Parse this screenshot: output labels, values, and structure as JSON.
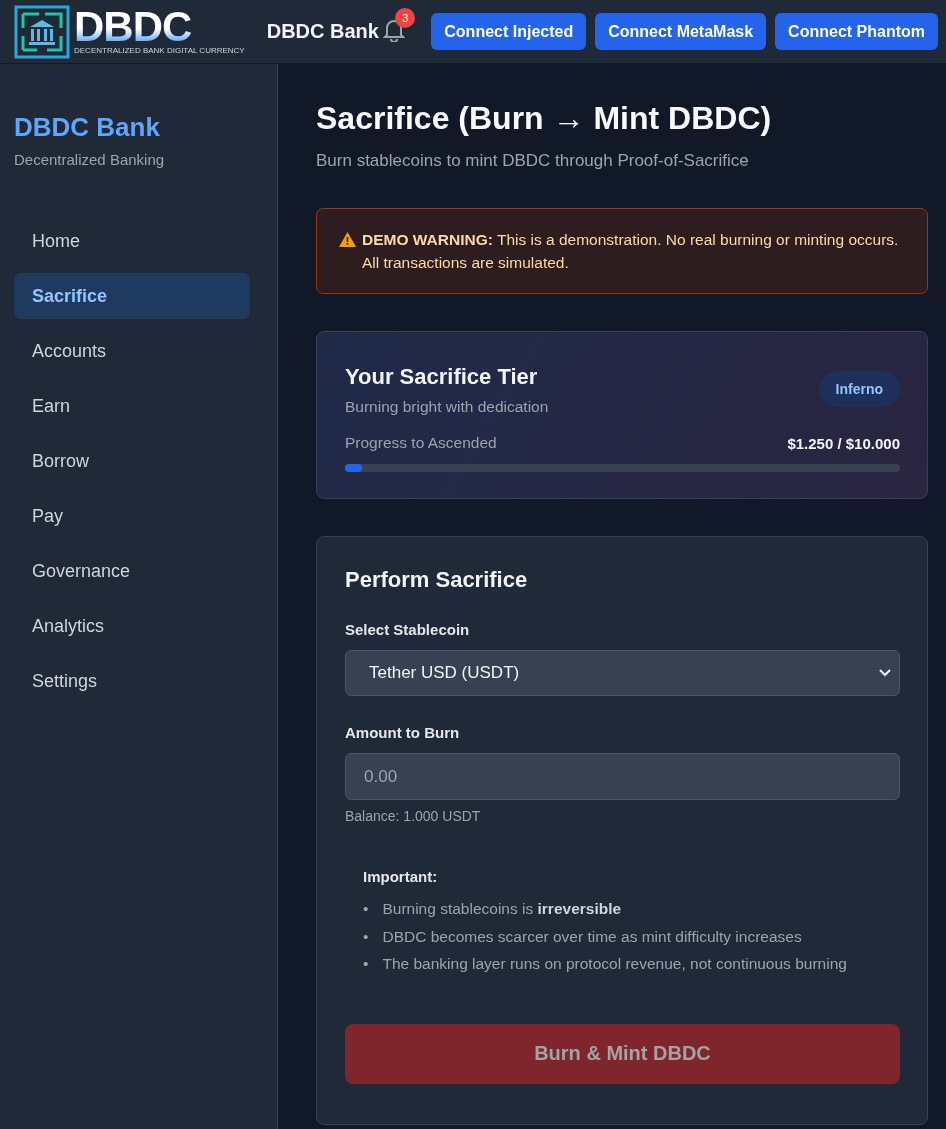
{
  "header": {
    "logo": {
      "wordmark": "DBDC",
      "tagline": "DECENTRALIZED BANK DIGITAL CURRENCY"
    },
    "title": "DBDC Bank",
    "notification_count": "3",
    "buttons": [
      "Connect Injected",
      "Connect MetaMask",
      "Connect Phantom"
    ]
  },
  "sidebar": {
    "title": "DBDC Bank",
    "subtitle": "Decentralized Banking",
    "items": [
      {
        "label": "Home",
        "selected": false
      },
      {
        "label": "Sacrifice",
        "selected": true
      },
      {
        "label": "Accounts",
        "selected": false
      },
      {
        "label": "Earn",
        "selected": false
      },
      {
        "label": "Borrow",
        "selected": false
      },
      {
        "label": "Pay",
        "selected": false
      },
      {
        "label": "Governance",
        "selected": false
      },
      {
        "label": "Analytics",
        "selected": false
      },
      {
        "label": "Settings",
        "selected": false
      }
    ]
  },
  "page": {
    "title": "Sacrifice (Burn → Mint DBDC)",
    "subtitle": "Burn stablecoins to mint DBDC through Proof-of-Sacrifice",
    "warning": {
      "text": "**DEMO WARNING:** This is a demonstration. No real burning or minting occurs. All transactions are simulated."
    },
    "tier_card": {
      "title": "Your Sacrifice Tier",
      "description": "Burning bright with dedication",
      "badge": "Inferno",
      "progress_label": "Progress to Ascended",
      "progress_value": "$1.250 / $10.000",
      "level": 0.03
    },
    "sacrifice_form": {
      "title": "Perform Sacrifice",
      "stablecoin": {
        "label": "Select Stablecoin",
        "value": "Tether USD (USDT)"
      },
      "amount": {
        "label": "Amount to Burn",
        "placeholder": "0.00",
        "hint": "Balance: 1.000 USDT"
      },
      "notice": {
        "title": "Important:",
        "marker": "•",
        "items": [
          "Burning stablecoins is **irreversible**",
          "DBDC becomes scarcer over time as mint difficulty increases",
          "The banking layer runs on protocol revenue, not continuous burning"
        ]
      },
      "submit": {
        "label": "Burn & Mint DBDC",
        "disabled": true
      }
    }
  }
}
